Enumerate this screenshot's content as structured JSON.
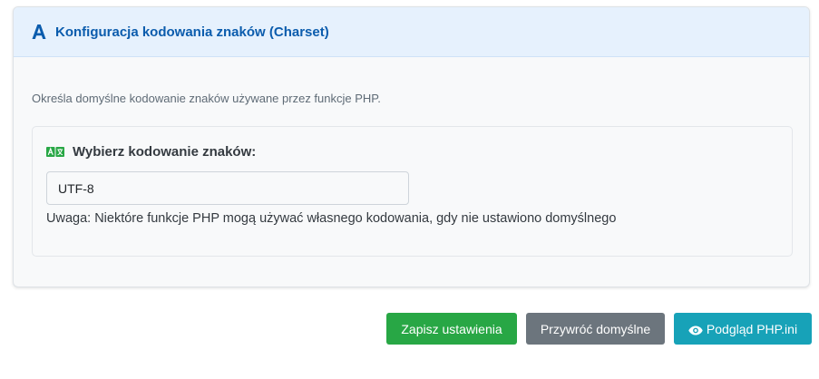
{
  "card": {
    "title": "Konfiguracja kodowania znaków (Charset)",
    "title_icon": "font-icon",
    "description": "Określa domyślne kodowanie znaków używane przez funkcje PHP."
  },
  "charset_field": {
    "label": "Wybierz kodowanie znaków:",
    "label_icon": "language-icon",
    "value": "UTF-8",
    "note": "Uwaga: Niektóre funkcje PHP mogą używać własnego kodowania, gdy nie ustawiono domyślnego"
  },
  "actions": {
    "save_label": "Zapisz ustawienia",
    "reset_label": "Przywróć domyślne",
    "preview_label": "Podgląd PHP.ini",
    "preview_icon": "eye-icon"
  },
  "colors": {
    "header_bg": "#e6f1fd",
    "title": "#0b5cad",
    "save": "#28a745",
    "reset": "#6c757d",
    "preview": "#17a2b8",
    "language_icon": "#28a745"
  }
}
